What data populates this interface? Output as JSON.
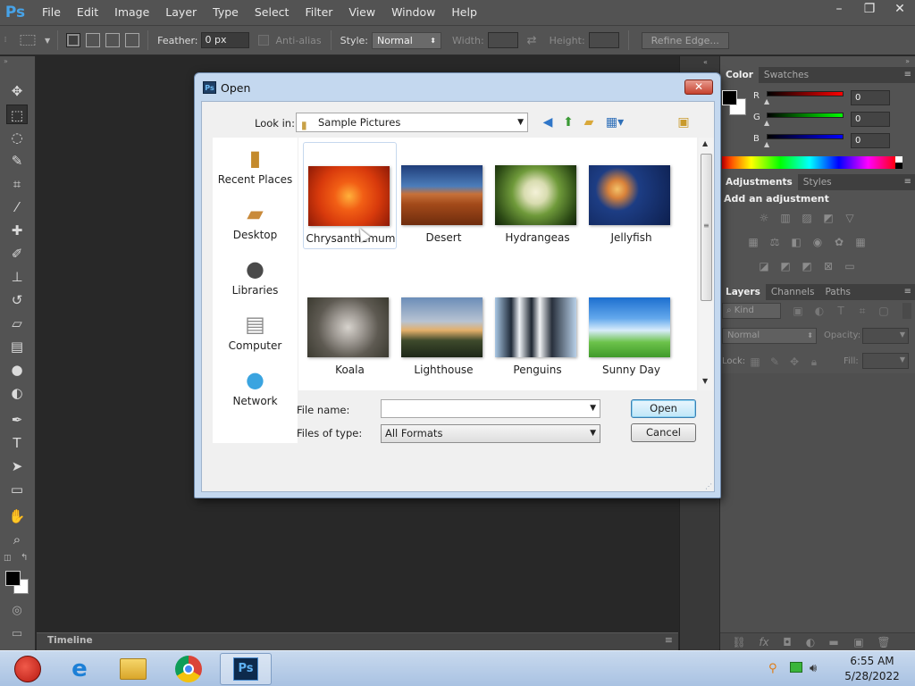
{
  "app": {
    "logo": "Ps"
  },
  "menubar": {
    "items": [
      "File",
      "Edit",
      "Image",
      "Layer",
      "Type",
      "Select",
      "Filter",
      "View",
      "Window",
      "Help"
    ],
    "window_controls": [
      "–",
      "❐",
      "✕"
    ]
  },
  "options_bar": {
    "feather_label": "Feather:",
    "feather_value": "0 px",
    "antialias_label": "Anti-alias",
    "style_label": "Style:",
    "style_value": "Normal",
    "width_label": "Width:",
    "height_label": "Height:",
    "refine_edge_label": "Refine Edge..."
  },
  "tools": [
    "move-tool-icon",
    "marquee-tool-icon",
    "lasso-tool-icon",
    "quick-selection-tool-icon",
    "crop-tool-icon",
    "eyedropper-tool-icon",
    "healing-brush-tool-icon",
    "brush-tool-icon",
    "clone-stamp-tool-icon",
    "history-brush-tool-icon",
    "eraser-tool-icon",
    "gradient-tool-icon",
    "blur-tool-icon",
    "dodge-tool-icon",
    "pen-tool-icon",
    "type-tool-icon",
    "path-selection-tool-icon",
    "rectangle-tool-icon",
    "hand-tool-icon",
    "zoom-tool-icon"
  ],
  "timeline": {
    "tab_label": "Timeline"
  },
  "color_panel": {
    "tabs": [
      "Color",
      "Swatches"
    ],
    "r_label": "R",
    "r_value": "0",
    "g_label": "G",
    "g_value": "0",
    "b_label": "B",
    "b_value": "0",
    "foreground_color": "#000000",
    "background_color": "#ffffff"
  },
  "adjustments_panel": {
    "tabs": [
      "Adjustments",
      "Styles"
    ],
    "heading": "Add an adjustment"
  },
  "layers_panel": {
    "tabs": [
      "Layers",
      "Channels",
      "Paths"
    ],
    "kind_label": "Kind",
    "blend_mode": "Normal",
    "opacity_label": "Opacity:",
    "lock_label": "Lock:",
    "fill_label": "Fill:"
  },
  "dialog": {
    "title": "Open",
    "icon_text": "Ps",
    "lookin_label": "Look in:",
    "lookin_value": "Sample Pictures",
    "places": [
      "Recent Places",
      "Desktop",
      "Libraries",
      "Computer",
      "Network"
    ],
    "files": [
      {
        "name": "Chrysanthemum",
        "selected": true
      },
      {
        "name": "Desert"
      },
      {
        "name": "Hydrangeas"
      },
      {
        "name": "Jellyfish"
      },
      {
        "name": "Koala"
      },
      {
        "name": "Lighthouse"
      },
      {
        "name": "Penguins"
      },
      {
        "name": "Sunny Day"
      }
    ],
    "file_name_label": "File name:",
    "file_name_value": "",
    "files_of_type_label": "Files of type:",
    "files_of_type_value": "All Formats",
    "open_button": "Open",
    "cancel_button": "Cancel"
  },
  "taskbar": {
    "apps": [
      "Angry Birds",
      "Internet Explorer",
      "Libraries",
      "Google Chrome",
      "Photoshop"
    ],
    "active_app_label": "Ps",
    "time": "6:55 AM",
    "date": "5/28/2022"
  }
}
